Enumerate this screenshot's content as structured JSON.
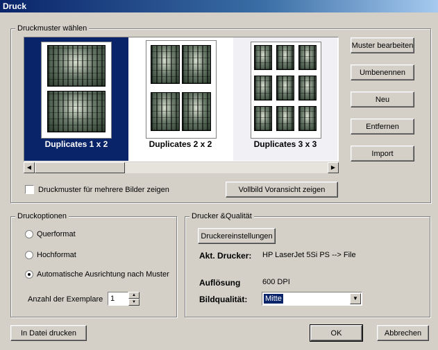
{
  "window": {
    "title": "Druck"
  },
  "patterns": {
    "legend": "Druckmuster wählen",
    "items": [
      {
        "label": "Duplicates 1 x 2",
        "selected": true
      },
      {
        "label": "Duplicates 2 x 2",
        "selected": false
      },
      {
        "label": "Duplicates 3 x 3",
        "selected": false
      }
    ],
    "buttons": {
      "edit": "Muster bearbeiten",
      "rename": "Umbenennen",
      "new": "Neu",
      "remove": "Entfernen",
      "import": "Import"
    },
    "multi_checkbox_label": "Druckmuster für mehrere Bilder zeigen",
    "multi_checkbox_checked": false,
    "preview_button": "Vollbild Voransicht zeigen"
  },
  "options": {
    "legend": "Druckoptionen",
    "landscape": "Querformat",
    "portrait": "Hochformat",
    "auto": "Automatische Ausrichtung nach Muster",
    "selected": "auto",
    "copies_label": "Anzahl der Exemplare",
    "copies_value": "1"
  },
  "printer": {
    "legend": "Drucker &Qualität",
    "settings_button": "Druckereinstellungen",
    "current_label": "Akt. Drucker:",
    "current_value": "HP LaserJet 5Si PS --> File",
    "resolution_label": "Auflösung",
    "resolution_value": "600 DPI",
    "quality_label": "Bildqualität:",
    "quality_value": "Mitte"
  },
  "footer": {
    "print_to_file": "In Datei drucken",
    "ok": "OK",
    "cancel": "Abbrechen"
  }
}
